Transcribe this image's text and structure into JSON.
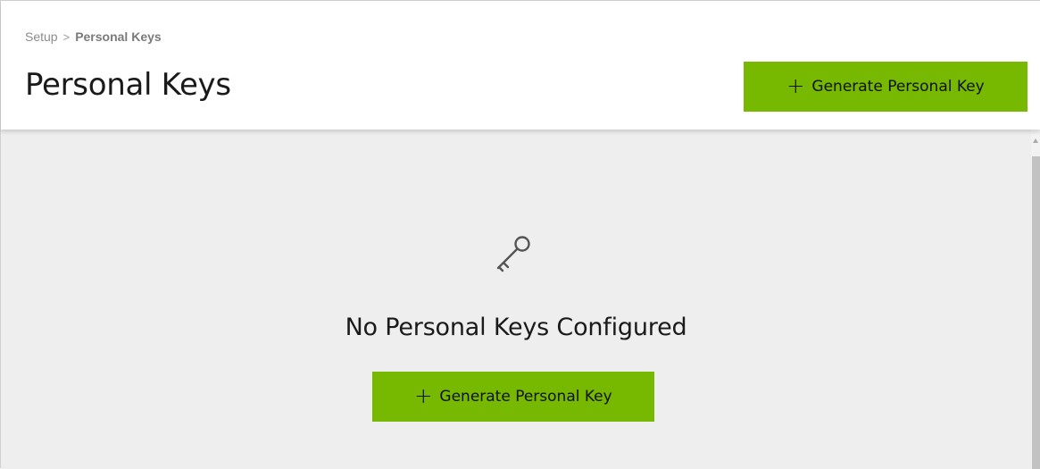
{
  "breadcrumb": {
    "parent": "Setup",
    "separator": ">",
    "current": "Personal Keys"
  },
  "page": {
    "title": "Personal Keys"
  },
  "header_action": {
    "icon": "plus-icon",
    "label": "Generate Personal Key"
  },
  "empty_state": {
    "icon": "key-icon",
    "title": "No Personal Keys Configured",
    "action": {
      "icon": "plus-icon",
      "label": "Generate Personal Key"
    }
  },
  "colors": {
    "accent": "#76b900",
    "content_background": "#eeeeee",
    "text": "#1a1a1a",
    "breadcrumb_text": "#8c8c8c"
  }
}
